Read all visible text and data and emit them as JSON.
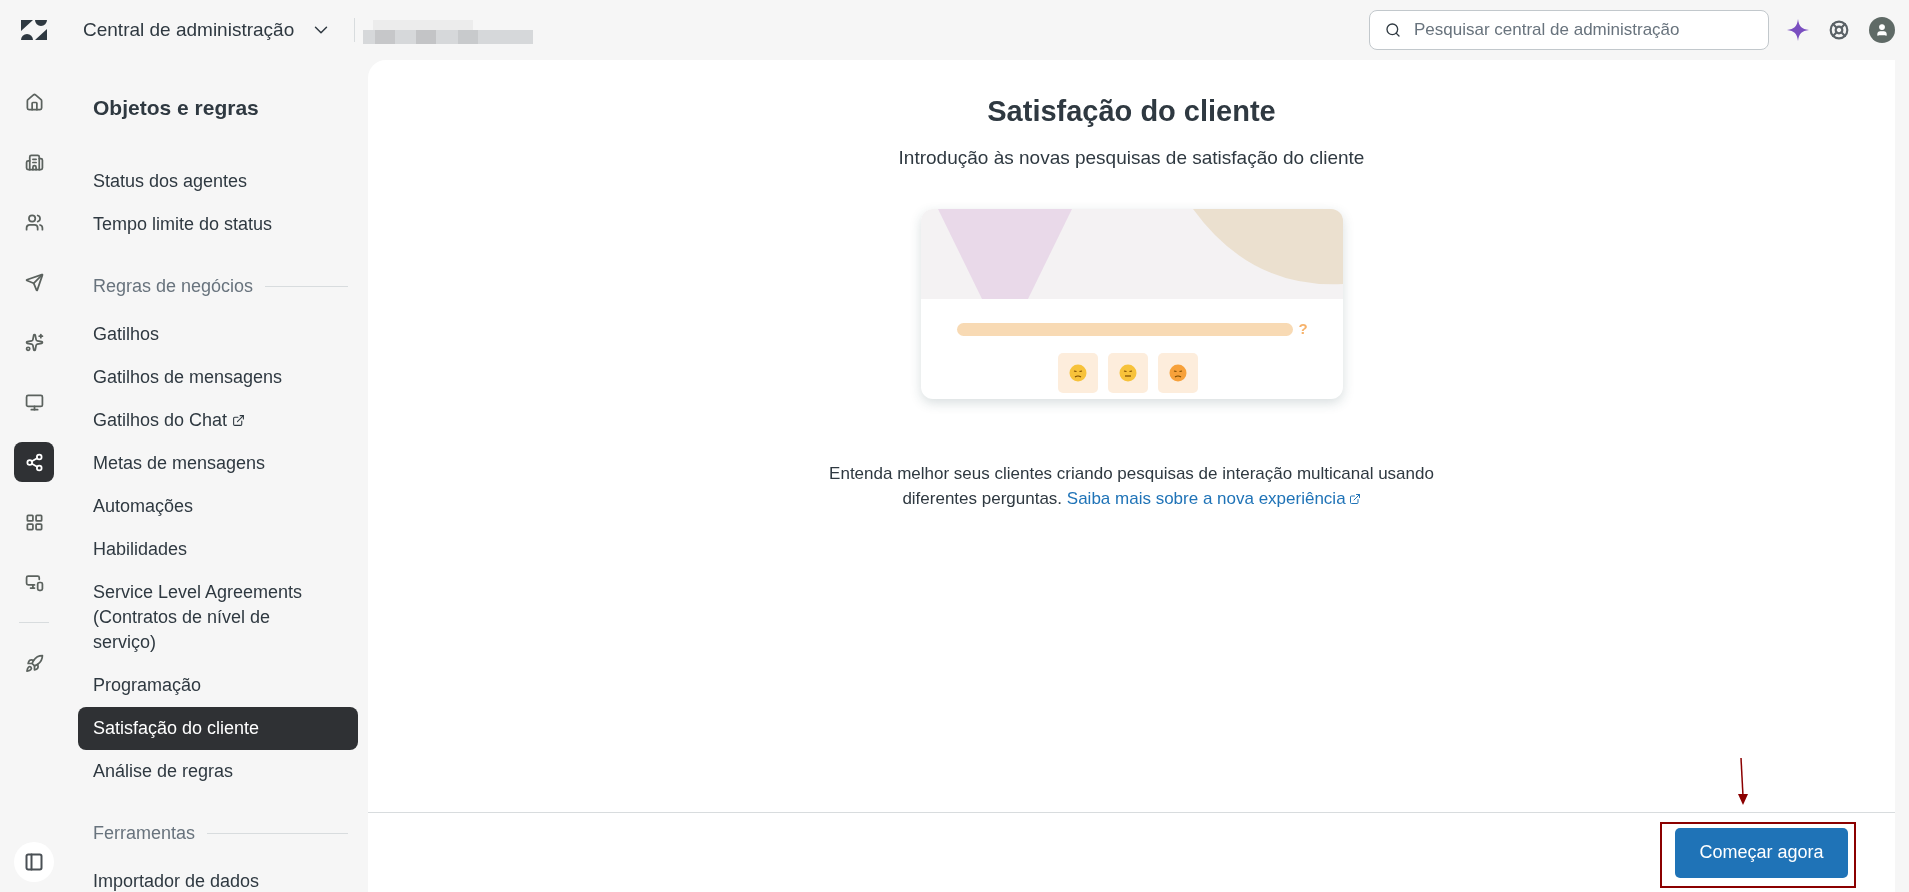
{
  "header": {
    "product": "Central de administração",
    "search": {
      "placeholder": "Pesquisar central de administração"
    }
  },
  "rail": [
    {
      "selected": false
    },
    {
      "selected": false
    },
    {
      "selected": false
    },
    {
      "selected": false
    },
    {
      "selected": false
    },
    {
      "selected": false
    },
    {
      "selected": true
    },
    {
      "selected": false
    },
    {
      "selected": false
    },
    {
      "selected": false
    }
  ],
  "nav": {
    "title": "Objetos e regras",
    "items": [
      {
        "kind": "item",
        "label": "Status dos agentes",
        "selected": false,
        "external": false
      },
      {
        "kind": "item",
        "label": "Tempo limite do status",
        "selected": false,
        "external": false
      },
      {
        "kind": "heading",
        "label": "Regras de negócios"
      },
      {
        "kind": "item",
        "label": "Gatilhos",
        "selected": false,
        "external": false
      },
      {
        "kind": "item",
        "label": "Gatilhos de mensagens",
        "selected": false,
        "external": false
      },
      {
        "kind": "item",
        "label": "Gatilhos do Chat",
        "selected": false,
        "external": true
      },
      {
        "kind": "item",
        "label": "Metas de mensagens",
        "selected": false,
        "external": false
      },
      {
        "kind": "item",
        "label": "Automações",
        "selected": false,
        "external": false
      },
      {
        "kind": "item",
        "label": "Habilidades",
        "selected": false,
        "external": false
      },
      {
        "kind": "item",
        "label": "Service Level Agreements (Contratos de nível de serviço)",
        "selected": false,
        "external": false
      },
      {
        "kind": "item",
        "label": "Programação",
        "selected": false,
        "external": false
      },
      {
        "kind": "item",
        "label": "Satisfação do cliente",
        "selected": true,
        "external": false
      },
      {
        "kind": "item",
        "label": "Análise de regras",
        "selected": false,
        "external": false
      },
      {
        "kind": "heading",
        "label": "Ferramentas"
      },
      {
        "kind": "item",
        "label": "Importador de dados",
        "selected": false,
        "external": false
      }
    ]
  },
  "main": {
    "title": "Satisfação do cliente",
    "subtitle": "Introdução às novas pesquisas de satisfação do cliente",
    "illustration": {
      "question_mark": "?"
    },
    "description": "Entenda melhor seus clientes criando pesquisas de interação multicanal usando diferentes perguntas.",
    "link": "Saiba mais sobre a nova experiência",
    "button": "Começar agora"
  }
}
